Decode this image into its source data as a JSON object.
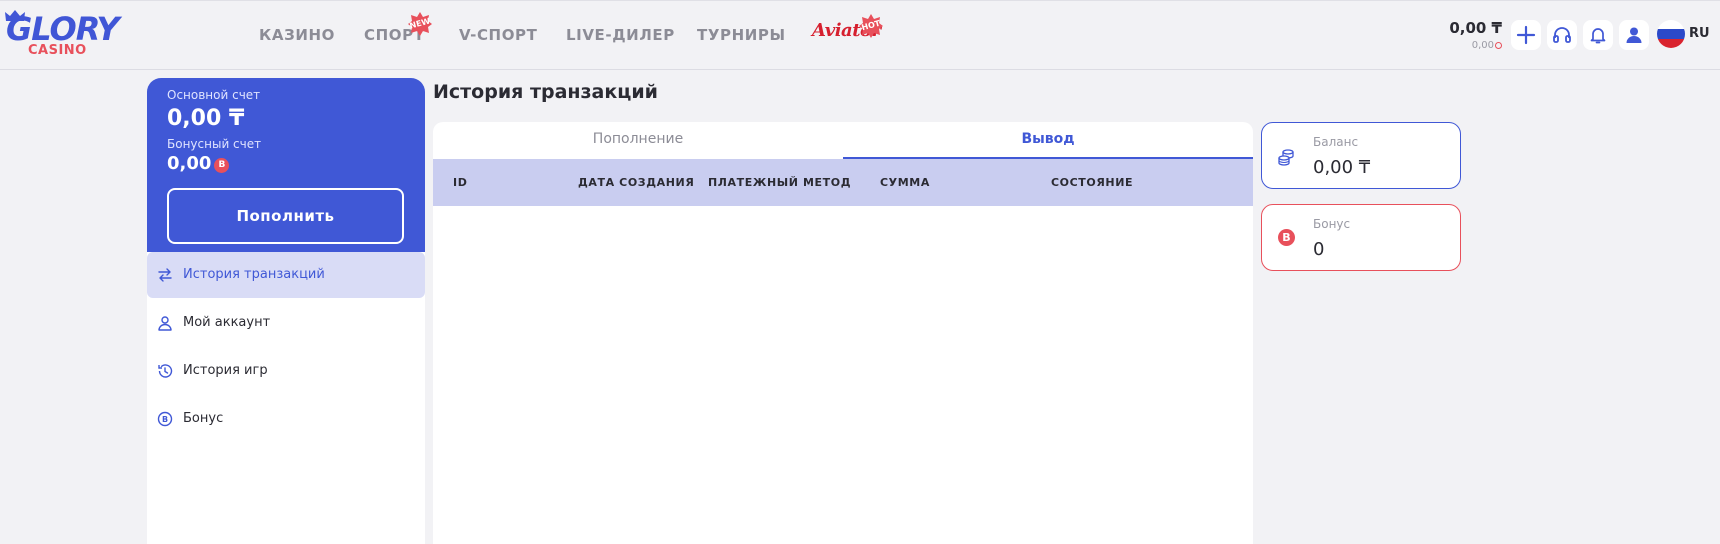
{
  "brand": {
    "name": "GLORY",
    "sub": "CASINO",
    "aviator": "Aviator"
  },
  "nav": [
    {
      "label": "КАЗИНО"
    },
    {
      "label": "СПОРТ",
      "badge": "NEW"
    },
    {
      "label": "V-СПОРТ"
    },
    {
      "label": "LIVE-ДИЛЕР"
    },
    {
      "label": "ТУРНИРЫ"
    }
  ],
  "aviator_badge": "HOT",
  "header": {
    "balance": "0,00 ₸",
    "bonus_balance": "0,00",
    "language": "RU"
  },
  "account": {
    "main_label": "Основной счет",
    "main_value": "0,00 ₸",
    "bonus_label": "Бонусный счет",
    "bonus_value": "0,00",
    "bonus_icon": "B",
    "deposit_button": "Пополнить"
  },
  "side_menu": [
    {
      "label": "История транзакций",
      "icon": "transfer-icon",
      "active": true
    },
    {
      "label": "Мой аккаунт",
      "icon": "user-icon"
    },
    {
      "label": "История игр",
      "icon": "history-icon"
    },
    {
      "label": "Бонус",
      "icon": "bonus-icon"
    }
  ],
  "page": {
    "title": "История транзакций",
    "tabs": [
      {
        "label": "Пополнение",
        "active": false
      },
      {
        "label": "Вывод",
        "active": true
      }
    ],
    "columns": [
      "ID",
      "ДАТА СОЗДАНИЯ",
      "ПЛАТЕЖНЫЙ МЕТОД",
      "СУММА",
      "СОСТОЯНИЕ"
    ]
  },
  "cards": {
    "balance_label": "Баланс",
    "balance_value": "0,00 ₸",
    "bonus_label": "Бонус",
    "bonus_value": "0",
    "bonus_icon": "B"
  },
  "colors": {
    "primary": "#4058d6",
    "accent": "#e8505b",
    "table_header": "#c9cdf0",
    "active_menu": "#d9dcf6"
  }
}
